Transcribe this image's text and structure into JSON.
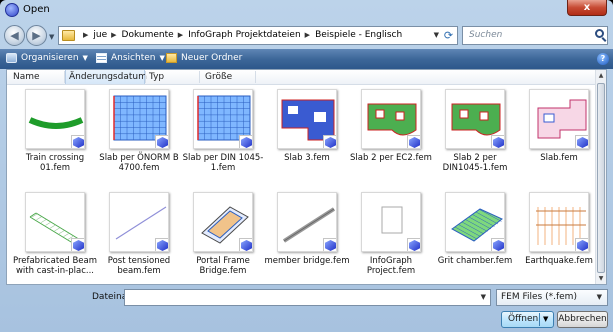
{
  "window": {
    "title": "Open",
    "close_label": "x"
  },
  "nav": {
    "back_glyph": "◀",
    "forward_glyph": "▶",
    "dropdown_glyph": "▼"
  },
  "address": {
    "folder_icon": "folder-icon",
    "crumbs": [
      "jue",
      "Dokumente",
      "InfoGraph Projektdateien",
      "Beispiele - Englisch"
    ],
    "separator": "▶",
    "refresh_glyph": "⟳"
  },
  "search": {
    "placeholder": "Suchen"
  },
  "toolbar": {
    "organize": "Organisieren",
    "views": "Ansichten",
    "new_folder": "Neuer Ordner",
    "arrow": "▼",
    "help": "?"
  },
  "columns": [
    "Name",
    "Änderungsdatum",
    "Typ",
    "Größe"
  ],
  "scrollbar": {
    "up": "▲",
    "down": "▼"
  },
  "files": [
    {
      "name": "Train crossing 01.fem",
      "thumb": "train"
    },
    {
      "name": "Slab per ÖNORM B 4700.fem",
      "thumb": "slabgrid"
    },
    {
      "name": "Slab per DIN 1045-1.fem",
      "thumb": "slabgrid"
    },
    {
      "name": "Slab 3.fem",
      "thumb": "slab3"
    },
    {
      "name": "Slab 2 per EC2.fem",
      "thumb": "slab2"
    },
    {
      "name": "Slab 2 per DIN1045-1.fem",
      "thumb": "slab2"
    },
    {
      "name": "Slab.fem",
      "thumb": "slab"
    },
    {
      "name": "Prefabricated Beam with cast-in-plac...",
      "thumb": "prefab"
    },
    {
      "name": "Post tensioned beam.fem",
      "thumb": "post"
    },
    {
      "name": "Portal Frame Bridge.fem",
      "thumb": "portal"
    },
    {
      "name": "member bridge.fem",
      "thumb": "member"
    },
    {
      "name": "InfoGraph Project.fem",
      "thumb": "project"
    },
    {
      "name": "Grit chamber.fem",
      "thumb": "grit"
    },
    {
      "name": "Earthquake.fem",
      "thumb": "quake"
    }
  ],
  "bottom": {
    "filename_label": "Dateiname:",
    "filename_value": "",
    "filetype": "FEM Files (*.fem)",
    "open": "Öffnen",
    "cancel": "Abbrechen",
    "dropdown_glyph": "▼"
  }
}
